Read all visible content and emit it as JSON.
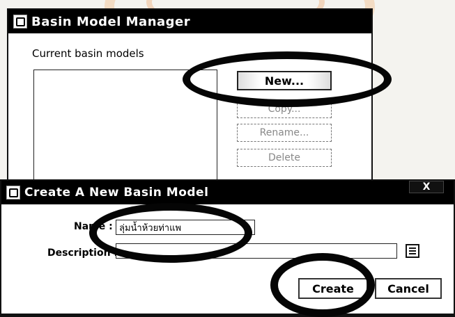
{
  "manager_window": {
    "title": "Basin Model Manager",
    "list_label": "Current basin models",
    "buttons": {
      "new": "New...",
      "copy": "Copy...",
      "rename": "Rename...",
      "delete": "Delete"
    }
  },
  "create_dialog": {
    "title": "Create A New Basin Model",
    "close_label": "X",
    "name_label": "Name :",
    "name_value": "ลุ่มน้ำห้วยท่าแพ",
    "description_label": "Description :",
    "description_value": "",
    "create_label": "Create",
    "cancel_label": "Cancel"
  },
  "colors": {
    "titlebar": "#000000",
    "annotation_oval": "#050505",
    "watermark": "#f3dcc4"
  },
  "icons": [
    "java-app-icon",
    "java-app-icon",
    "file-picker-icon"
  ]
}
